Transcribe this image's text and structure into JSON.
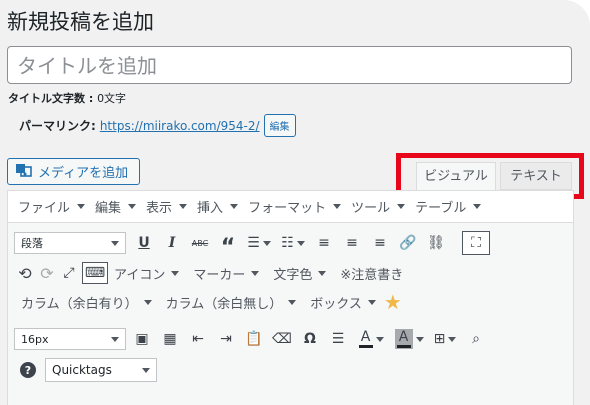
{
  "page": {
    "title": "新規投稿を追加"
  },
  "title_field": {
    "placeholder": "タイトルを追加"
  },
  "word_count": {
    "label": "タイトル文字数 : ",
    "value": "0文字"
  },
  "permalink": {
    "label": "パーマリンク:",
    "url": "https://miirako.com/954-2/",
    "edit_label": "編集"
  },
  "media_button": {
    "label": "メディアを追加",
    "icon": "media-icon"
  },
  "editor_tabs": {
    "visual": "ビジュアル",
    "text": "テキスト",
    "highlight_color": "#e8061a"
  },
  "menubar": {
    "items": [
      "ファイル",
      "編集",
      "表示",
      "挿入",
      "フォーマット",
      "ツール",
      "テーブル"
    ]
  },
  "toolbar1": {
    "format_select": "段落"
  },
  "toolbar2": {
    "icon_button": "アイコン",
    "marker": "マーカー",
    "text_color": "文字色",
    "note": "※注意書き"
  },
  "toolbar3": {
    "column_with_bg": "カラム（余白有り）",
    "column_no_bg": "カラム（余白無し）",
    "box": "ボックス"
  },
  "toolbar4": {
    "font_size": "16px"
  },
  "toolbar5": {
    "quicktags": "Quicktags"
  },
  "colors": {
    "accent": "#2271b1",
    "star": "#f0b849"
  }
}
